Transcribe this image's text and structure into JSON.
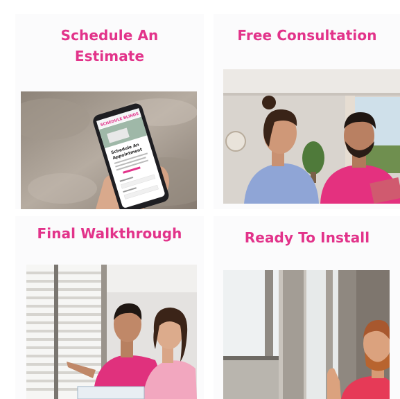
{
  "cards": [
    {
      "title_line1": "Schedule An",
      "title_line2": "Estimate",
      "image": "phone-booking-photo"
    },
    {
      "title_line1": "Free Consultation",
      "image": "consultation-photo"
    },
    {
      "title_line1": "Final Walkthrough",
      "image": "walkthrough-photo"
    },
    {
      "title_line1": "Ready To Install",
      "image": "installer-photo"
    }
  ],
  "phone_screen": {
    "brand": "SCHEDULE BLINDS",
    "heading_line1": "Schedule An",
    "heading_line2": "Appointment"
  },
  "colors": {
    "accent": "#e2338a",
    "card_bg": "#fbfbfc"
  }
}
